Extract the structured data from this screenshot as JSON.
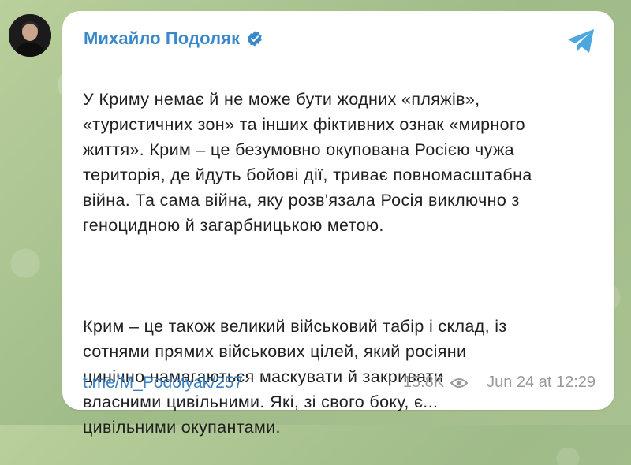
{
  "post": {
    "author": "Михайло Подоляк",
    "paragraph1": "У Криму немає й не може бути жодних «пляжів»,\n«туристичних зон» та інших фіктивних ознак «мирного\nжиття». Крим – це безумовно окупована Росією чужа\nтериторія, де йдуть бойові дії, триває повномасштабна\nвійна. Та сама війна, яку розв'язала Росія виключно з\nгеноцидною й загарбницькою метою.",
    "paragraph2": "Крим – це також великий військовий табір і склад, із\nсотнями прямих військових цілей, який росіяни\nцинічно намагаються маскувати й закривати\nвласними цивільними. Які, зі свого боку, є...\nцивільними окупантами.",
    "link": "t.me/M_Podolyak/257",
    "views": "15.8K",
    "date": "Jun 24 at 12:29"
  },
  "icons": {
    "verified": "verified-badge-icon",
    "share": "telegram-share-icon",
    "views": "eye-icon"
  },
  "colors": {
    "accent": "#3a88c9",
    "link": "#3a7fc0",
    "meta": "#9a9a9a",
    "background": "#a7c08f"
  }
}
